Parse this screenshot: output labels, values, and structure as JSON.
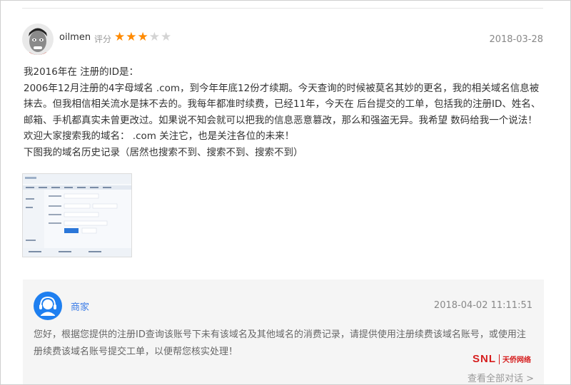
{
  "review": {
    "username": "oilmen",
    "rating_label": "评分",
    "rating": 3,
    "rating_max": 5,
    "date": "2018-03-28",
    "paragraphs": [
      "我2016年在      注册的ID是：",
      "2006年12月注册的4字母域名           .com，到今年年底12份才续期。今天查询的时候被莫名其妙的更名，我的相关域名信息被抹去。但我相信相关流水是抹不去的。我每年都准时续费，已经11年，今天在       后台提交的工单，包括我的注册ID、姓名、邮箱、手机都真实未曾更改过。如果说不知会就可以把我的信息恶意篡改，那么和强盗无异。我希望        数码给我一个说法！",
      "欢迎大家搜索我的域名：         .com 关注它，也是关注各位的未来！",
      "下图我的域名历史记录（居然也搜索不到、搜索不到、搜索不到）"
    ]
  },
  "reply": {
    "merchant_name": "商家",
    "date": "2018-04-02 11:11:51",
    "text": "您好，根据您提供的注册ID查询该账号下未有该域名及其他域名的消费记录，请提供使用注册续费该域名账号，或使用注册续费该域名账号提交工单，以便帮您核实处理！",
    "view_all": "查看全部对话 >"
  },
  "watermark": {
    "brand": "SNL",
    "name_cn": "天侨网络"
  },
  "colors": {
    "star_on": "#ff8a00",
    "star_off": "#d4d4d4",
    "merchant_blue": "#1e7ff0",
    "link_blue": "#3a7be6",
    "reply_bg": "#f5f5f5",
    "watermark_red": "#d61d1d"
  }
}
